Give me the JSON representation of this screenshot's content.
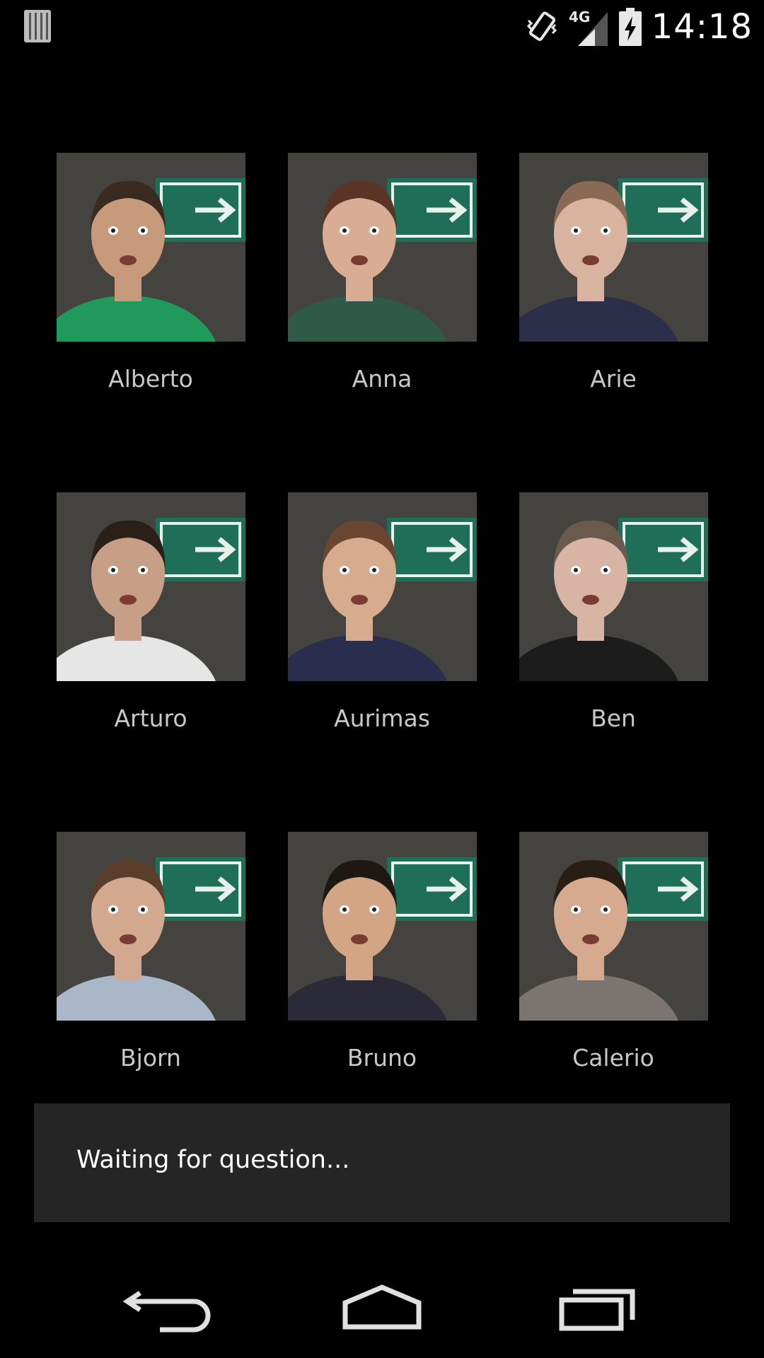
{
  "status_bar": {
    "time": "14:18",
    "network": "4G",
    "icons": [
      "notification-bars-icon",
      "vibrate-icon",
      "signal-icon",
      "battery-charging-icon"
    ]
  },
  "people": [
    {
      "name": "Alberto",
      "shirt": "#1f9a5a",
      "skin": "#c79a7c",
      "hair": "#3a2a20"
    },
    {
      "name": "Anna",
      "shirt": "#2f5a48",
      "skin": "#d9ad94",
      "hair": "#5a3526"
    },
    {
      "name": "Arie",
      "shirt": "#2b2f4a",
      "skin": "#d8b3a0",
      "hair": "#8a6a55"
    },
    {
      "name": "Arturo",
      "shirt": "#e6e6e6",
      "skin": "#c79e86",
      "hair": "#2a2019"
    },
    {
      "name": "Aurimas",
      "shirt": "#2a2e4e",
      "skin": "#d7ab8d",
      "hair": "#6a4632"
    },
    {
      "name": "Ben",
      "shirt": "#1c1c1c",
      "skin": "#d8b4a4",
      "hair": "#6a5a4e"
    },
    {
      "name": "Bjorn",
      "shirt": "#a9b7c9",
      "skin": "#d2a98f",
      "hair": "#5a3d2a"
    },
    {
      "name": "Bruno",
      "shirt": "#2a2a38",
      "skin": "#d4a585",
      "hair": "#1e1813"
    },
    {
      "name": "Calerio",
      "shirt": "#7a7570",
      "skin": "#d6aa8e",
      "hair": "#2a1d16"
    }
  ],
  "toast": {
    "message": "Waiting for question..."
  },
  "nav": {
    "icons": [
      "back-icon",
      "home-icon",
      "recent-apps-icon"
    ]
  },
  "colors": {
    "background": "#000000",
    "toast_bg": "#252525",
    "sign_green": "#1f6e58"
  }
}
